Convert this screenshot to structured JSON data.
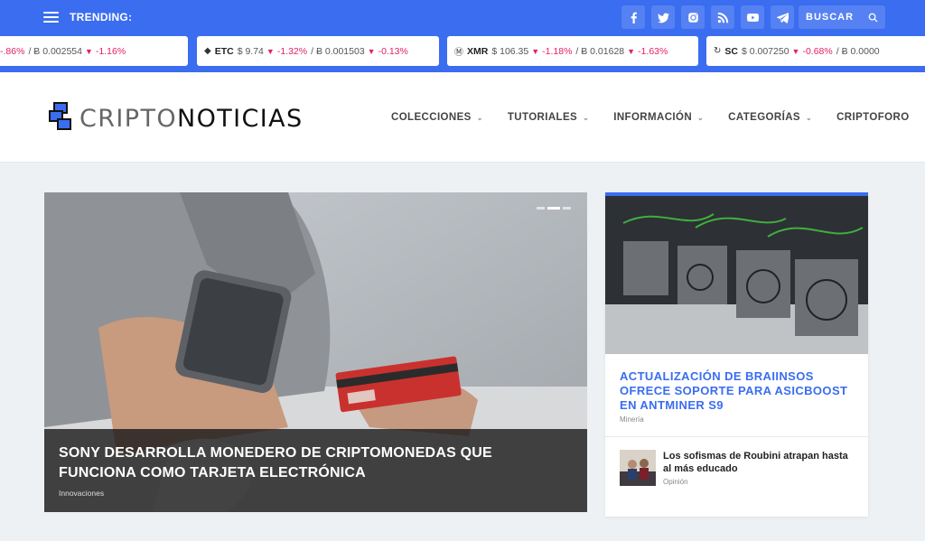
{
  "topbar": {
    "trending_label": "TRENDING:",
    "search_placeholder": "BUSCAR",
    "socials": [
      "facebook-icon",
      "twitter-icon",
      "instagram-icon",
      "rss-icon",
      "youtube-icon",
      "telegram-icon"
    ],
    "accent_color": "#3a6df0"
  },
  "ticker": [
    {
      "symbol": "",
      "usd": "",
      "change_usd": "-.86%",
      "btc": "/ Ƀ 0.002554",
      "change_btc": "-1.16%"
    },
    {
      "symbol": "ETC",
      "usd": "$ 9.74",
      "change_usd": "-1.32%",
      "btc": "/ Ƀ 0.001503",
      "change_btc": "-0.13%"
    },
    {
      "symbol": "XMR",
      "usd": "$ 106.35",
      "change_usd": "-1.18%",
      "btc": "/ Ƀ 0.01628",
      "change_btc": "-1.63%"
    },
    {
      "symbol": "SC",
      "usd": "$ 0.007250",
      "change_usd": "-0.68%",
      "btc": "/ Ƀ 0.0000",
      "change_btc": ""
    }
  ],
  "header": {
    "logo_part1": "CRIPTO",
    "logo_part2": "NOTICIAS",
    "nav": [
      {
        "label": "COLECCIONES",
        "dropdown": true
      },
      {
        "label": "TUTORIALES",
        "dropdown": true
      },
      {
        "label": "INFORMACIÓN",
        "dropdown": true
      },
      {
        "label": "CATEGORÍAS",
        "dropdown": true
      },
      {
        "label": "CRIPTOFORO",
        "dropdown": false
      }
    ]
  },
  "featured": {
    "title": "SONY DESARROLLA MONEDERO DE CRIPTOMONEDAS QUE FUNCIONA COMO TARJETA ELECTRÓNICA",
    "category": "Innovaciones"
  },
  "side": {
    "title": "ACTUALIZACIÓN DE BRAIINSOS OFRECE SOPORTE PARA ASICBOOST EN ANTMINER S9",
    "category": "Minería",
    "mini": {
      "title": "Los sofismas de Roubini atrapan hasta al más educado",
      "category": "Opinión"
    }
  }
}
